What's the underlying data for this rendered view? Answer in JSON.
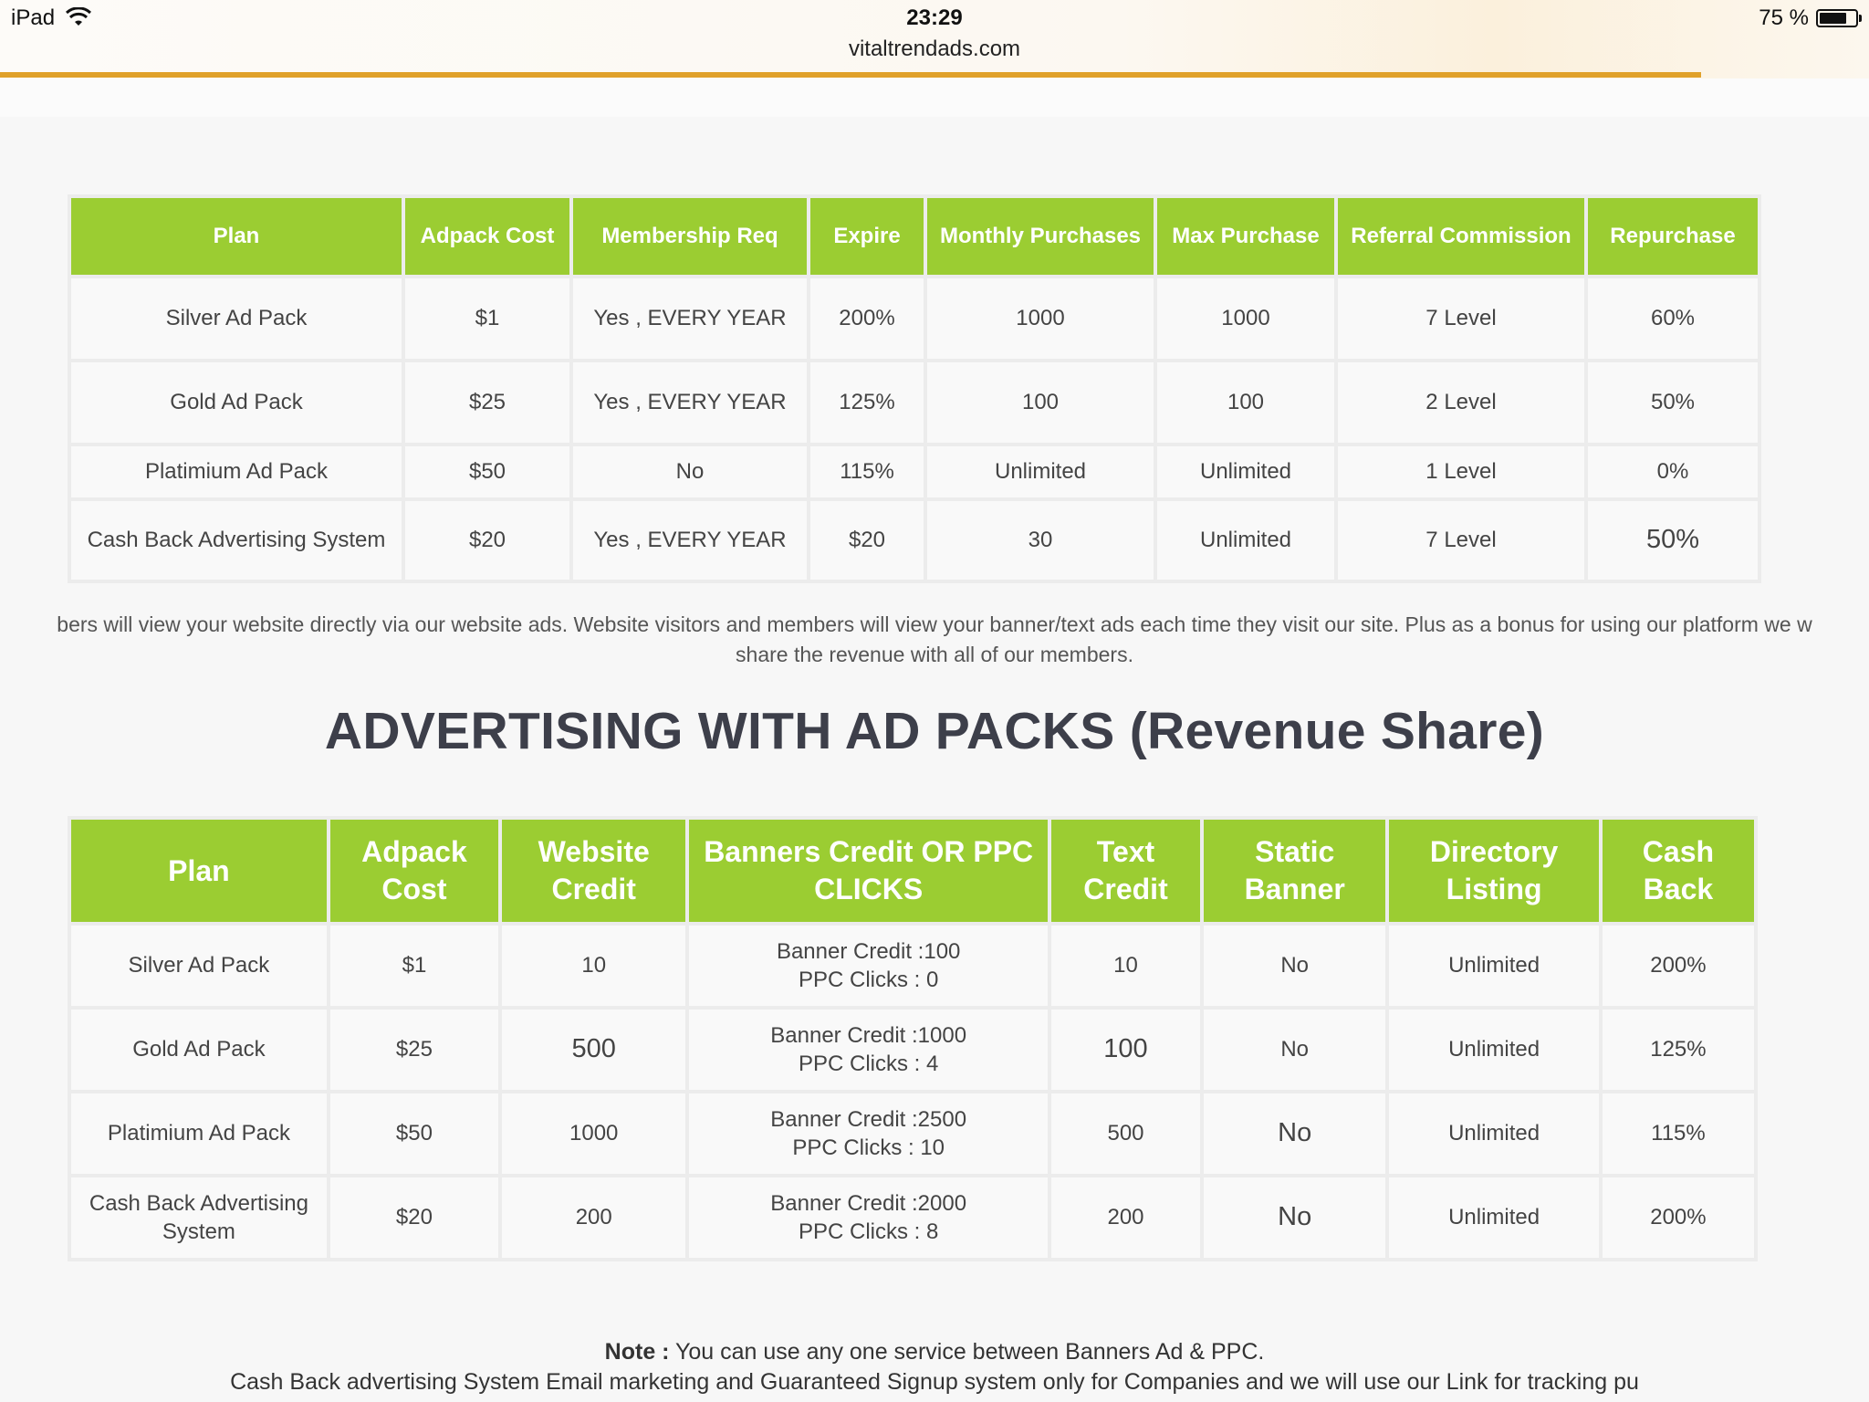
{
  "status_bar": {
    "device": "iPad",
    "time": "23:29",
    "url": "vitaltrendads.com",
    "battery": "75 %",
    "battery_level": 0.75,
    "page_load_progress": 0.91
  },
  "colors": {
    "header_green": "#9bcd32",
    "load_bar": "#e0a12a",
    "heading_text": "#3d3f4a"
  },
  "table1": {
    "headers": [
      "Plan",
      "Adpack Cost",
      "Membership Req",
      "Expire",
      "Monthly Purchases",
      "Max Purchase",
      "Referral Commission",
      "Repurchase"
    ],
    "rows": [
      [
        "Silver Ad Pack",
        "$1",
        "Yes , EVERY YEAR",
        "200%",
        "1000",
        "1000",
        "7 Level",
        "60%"
      ],
      [
        "Gold Ad Pack",
        "$25",
        "Yes , EVERY YEAR",
        "125%",
        "100",
        "100",
        "2 Level",
        "50%"
      ],
      [
        "Platimium Ad Pack",
        "$50",
        "No",
        "115%",
        "Unlimited",
        "Unlimited",
        "1 Level",
        "0%"
      ],
      [
        "Cash Back Advertising System",
        "$20",
        "Yes , EVERY YEAR",
        "$20",
        "30",
        "Unlimited",
        "7 Level",
        "50%"
      ]
    ]
  },
  "description": {
    "line1": "bers will view your website directly via our website ads. Website visitors and members will view your banner/text ads each time they visit our site. Plus as a bonus for using our platform we w",
    "line2": "share the revenue with all of our members."
  },
  "heading": "ADVERTISING WITH AD PACKS (Revenue Share)",
  "table2": {
    "headers": [
      "Plan",
      "Adpack Cost",
      "Website Credit",
      "Banners Credit OR PPC CLICKS",
      "Text Credit",
      "Static Banner",
      "Directory Listing",
      "Cash Back"
    ],
    "rows": [
      [
        "Silver Ad Pack",
        "$1",
        "10",
        "Banner Credit :100",
        "PPC Clicks : 0",
        "10",
        "No",
        "Unlimited",
        "200%"
      ],
      [
        "Gold Ad Pack",
        "$25",
        "500",
        "Banner Credit :1000",
        "PPC Clicks : 4",
        "100",
        "No",
        "Unlimited",
        "125%"
      ],
      [
        "Platimium Ad Pack",
        "$50",
        "1000",
        "Banner Credit :2500",
        "PPC Clicks : 10",
        "500",
        "No",
        "Unlimited",
        "115%"
      ],
      [
        "Cash Back Advertising System",
        "$20",
        "200",
        "Banner Credit :2000",
        "PPC Clicks : 8",
        "200",
        "No",
        "Unlimited",
        "200%"
      ]
    ]
  },
  "note": {
    "label": "Note :",
    "text": " You can use any one service between Banners Ad & PPC.",
    "line2": "Cash Back advertising System Email marketing and Guaranteed Signup system only for Companies and we will use our Link for tracking pu"
  }
}
